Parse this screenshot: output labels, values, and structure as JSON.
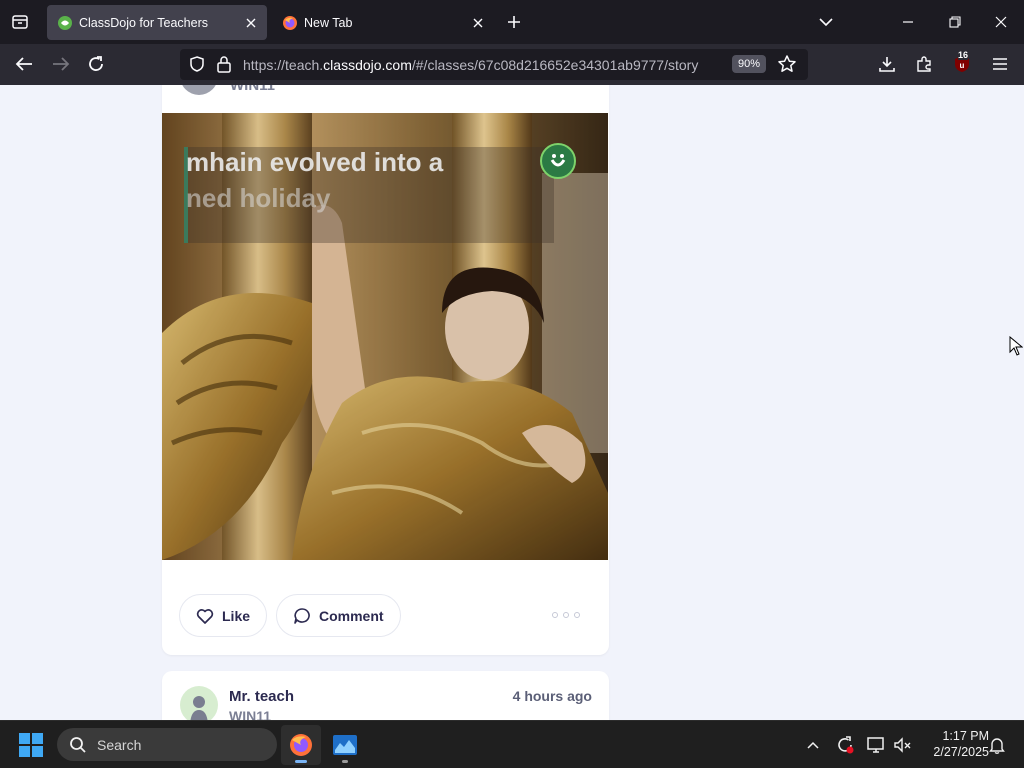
{
  "browser": {
    "tabs": [
      {
        "title": "ClassDojo for Teachers",
        "active": true,
        "icon": "classdojo-icon"
      },
      {
        "title": "New Tab",
        "active": false,
        "icon": "firefox-icon"
      }
    ],
    "url": {
      "prefix": "https://teach.",
      "domain": "classdojo.com",
      "path": "/#/classes/67c08d216652e34301ab9777/story"
    },
    "zoom": "90%",
    "extension_badge": "16"
  },
  "post1": {
    "class_name": "WIN11",
    "caption_line1": "mhain evolved into a",
    "caption_line2": "ned holiday",
    "like_label": "Like",
    "comment_label": "Comment"
  },
  "post2": {
    "author": "Mr. teach",
    "class_name": "WIN11",
    "time": "4 hours ago"
  },
  "taskbar": {
    "search_label": "Search",
    "time": "1:17 PM",
    "date": "2/27/2025"
  },
  "colors": {
    "tab_bar": "#1c1b22",
    "nav_bar": "#2b2a33",
    "page_bg": "#f1f3fb",
    "text_dark": "#2c2a50",
    "dojo_green": "#2b7a44"
  }
}
